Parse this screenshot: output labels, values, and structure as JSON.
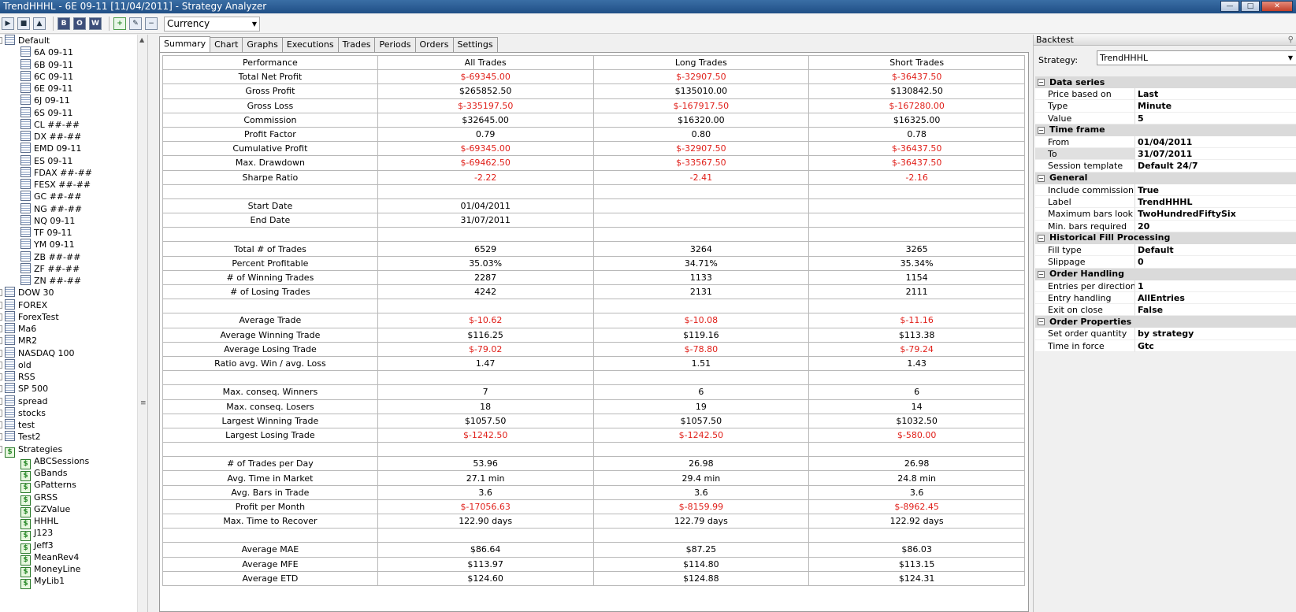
{
  "window": {
    "title": "TrendHHHL - 6E 09-11 [11/04/2011] - Strategy Analyzer"
  },
  "toolbar": {
    "currency": "Currency"
  },
  "tree": {
    "root": "Default",
    "instruments": [
      "6A 09-11",
      "6B 09-11",
      "6C 09-11",
      "6E 09-11",
      "6J 09-11",
      "6S 09-11",
      "CL ##-##",
      "DX ##-##",
      "EMD 09-11",
      "ES 09-11",
      "FDAX ##-##",
      "FESX ##-##",
      "GC ##-##",
      "NG ##-##",
      "NQ 09-11",
      "TF 09-11",
      "YM 09-11",
      "ZB ##-##",
      "ZF ##-##",
      "ZN ##-##"
    ],
    "lists": [
      "DOW 30",
      "FOREX",
      "ForexTest",
      "Ma6",
      "MR2",
      "NASDAQ 100",
      "old",
      "RSS",
      "SP 500",
      "spread",
      "stocks",
      "test",
      "Test2"
    ],
    "strategies_label": "Strategies",
    "strategies": [
      "ABCSessions",
      "GBands",
      "GPatterns",
      "GRSS",
      "GZValue",
      "HHHL",
      "J123",
      "Jeff3",
      "MeanRev4",
      "MoneyLine",
      "MyLib1"
    ]
  },
  "tabs": [
    "Summary",
    "Chart",
    "Graphs",
    "Executions",
    "Trades",
    "Periods",
    "Orders",
    "Settings"
  ],
  "table": {
    "headers": [
      "Performance",
      "All Trades",
      "Long Trades",
      "Short Trades"
    ],
    "rows": [
      [
        "Total Net Profit",
        "$-69345.00",
        "$-32907.50",
        "$-36437.50"
      ],
      [
        "Gross Profit",
        "$265852.50",
        "$135010.00",
        "$130842.50"
      ],
      [
        "Gross Loss",
        "$-335197.50",
        "$-167917.50",
        "$-167280.00"
      ],
      [
        "Commission",
        "$32645.00",
        "$16320.00",
        "$16325.00"
      ],
      [
        "Profit Factor",
        "0.79",
        "0.80",
        "0.78"
      ],
      [
        "Cumulative Profit",
        "$-69345.00",
        "$-32907.50",
        "$-36437.50"
      ],
      [
        "Max. Drawdown",
        "$-69462.50",
        "$-33567.50",
        "$-36437.50"
      ],
      [
        "Sharpe Ratio",
        "-2.22",
        "-2.41",
        "-2.16"
      ],
      [
        "",
        "",
        "",
        ""
      ],
      [
        "Start Date",
        "01/04/2011",
        "",
        ""
      ],
      [
        "End Date",
        "31/07/2011",
        "",
        ""
      ],
      [
        "",
        "",
        "",
        ""
      ],
      [
        "Total # of Trades",
        "6529",
        "3264",
        "3265"
      ],
      [
        "Percent Profitable",
        "35.03%",
        "34.71%",
        "35.34%"
      ],
      [
        "# of Winning Trades",
        "2287",
        "1133",
        "1154"
      ],
      [
        "# of Losing Trades",
        "4242",
        "2131",
        "2111"
      ],
      [
        "",
        "",
        "",
        ""
      ],
      [
        "Average Trade",
        "$-10.62",
        "$-10.08",
        "$-11.16"
      ],
      [
        "Average Winning Trade",
        "$116.25",
        "$119.16",
        "$113.38"
      ],
      [
        "Average Losing Trade",
        "$-79.02",
        "$-78.80",
        "$-79.24"
      ],
      [
        "Ratio avg. Win / avg. Loss",
        "1.47",
        "1.51",
        "1.43"
      ],
      [
        "",
        "",
        "",
        ""
      ],
      [
        "Max. conseq. Winners",
        "7",
        "6",
        "6"
      ],
      [
        "Max. conseq. Losers",
        "18",
        "19",
        "14"
      ],
      [
        "Largest Winning Trade",
        "$1057.50",
        "$1057.50",
        "$1032.50"
      ],
      [
        "Largest Losing Trade",
        "$-1242.50",
        "$-1242.50",
        "$-580.00"
      ],
      [
        "",
        "",
        "",
        ""
      ],
      [
        "# of Trades per Day",
        "53.96",
        "26.98",
        "26.98"
      ],
      [
        "Avg. Time in Market",
        "27.1 min",
        "29.4 min",
        "24.8 min"
      ],
      [
        "Avg. Bars in Trade",
        "3.6",
        "3.6",
        "3.6"
      ],
      [
        "Profit per Month",
        "$-17056.63",
        "$-8159.99",
        "$-8962.45"
      ],
      [
        "Max. Time to Recover",
        "122.90 days",
        "122.79 days",
        "122.92 days"
      ],
      [
        "",
        "",
        "",
        ""
      ],
      [
        "Average MAE",
        "$86.64",
        "$87.25",
        "$86.03"
      ],
      [
        "Average MFE",
        "$113.97",
        "$114.80",
        "$113.15"
      ],
      [
        "Average ETD",
        "$124.60",
        "$124.88",
        "$124.31"
      ]
    ],
    "negative_color": "#e0201a"
  },
  "panel": {
    "title": "Backtest",
    "strategy_label": "Strategy:",
    "strategy_value": "TrendHHHL",
    "categories": [
      {
        "name": "Data series",
        "props": [
          [
            "Price based on",
            "Last"
          ],
          [
            "Type",
            "Minute"
          ],
          [
            "Value",
            "5"
          ]
        ]
      },
      {
        "name": "Time frame",
        "props": [
          [
            "From",
            "01/04/2011"
          ],
          [
            "To",
            "31/07/2011"
          ],
          [
            "Session template",
            "Default 24/7"
          ]
        ]
      },
      {
        "name": "General",
        "props": [
          [
            "Include commission",
            "True"
          ],
          [
            "Label",
            "TrendHHHL"
          ],
          [
            "Maximum bars look bac",
            "TwoHundredFiftySix"
          ],
          [
            "Min. bars required",
            "20"
          ]
        ]
      },
      {
        "name": "Historical Fill Processing",
        "props": [
          [
            "Fill type",
            "Default"
          ],
          [
            "Slippage",
            "0"
          ]
        ]
      },
      {
        "name": "Order Handling",
        "props": [
          [
            "Entries per direction",
            "1"
          ],
          [
            "Entry handling",
            "AllEntries"
          ],
          [
            "Exit on close",
            "False"
          ]
        ]
      },
      {
        "name": "Order Properties",
        "props": [
          [
            "Set order quantity",
            "by strategy"
          ],
          [
            "Time in force",
            "Gtc"
          ]
        ]
      }
    ]
  }
}
